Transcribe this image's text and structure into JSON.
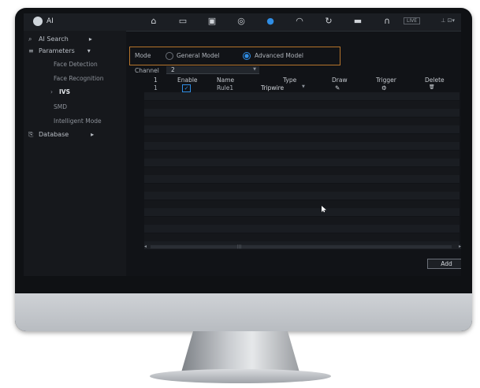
{
  "app": {
    "title": "AI"
  },
  "top_icons": [
    "home-icon",
    "monitor-icon",
    "playback-icon",
    "network-icon",
    "ai-icon",
    "speed-icon",
    "refresh-icon",
    "display-icon",
    "headset-icon"
  ],
  "top_right": {
    "live": "LIVE",
    "icons": "⊥ ⊡▾"
  },
  "sidebar": {
    "items": [
      {
        "label": "AI Search",
        "icon": "search-icon",
        "arrow": "▸"
      },
      {
        "label": "Parameters",
        "icon": "list-icon",
        "arrow": "▾"
      },
      {
        "label": "Database",
        "icon": "database-icon",
        "arrow": "▸"
      }
    ],
    "subitems": [
      {
        "label": "Face Detection"
      },
      {
        "label": "Face Recognition"
      },
      {
        "label": "IVS",
        "active": true
      },
      {
        "label": "SMD"
      },
      {
        "label": "Intelligent Mode"
      }
    ]
  },
  "mode": {
    "label": "Mode",
    "options": [
      {
        "label": "General Model",
        "selected": false
      },
      {
        "label": "Advanced Model",
        "selected": true
      }
    ]
  },
  "channel": {
    "label": "Channel",
    "value": "2"
  },
  "table": {
    "headers": [
      "1",
      "Enable",
      "Name",
      "Type",
      "Draw",
      "Trigger",
      "Delete"
    ],
    "rows": [
      {
        "index": "1",
        "enabled": true,
        "name": "Rule1",
        "type": "Tripwire",
        "draw": "✎",
        "trigger": "⚙",
        "delete": "🗑"
      }
    ]
  },
  "buttons": {
    "add": "Add"
  },
  "colors": {
    "accent": "#2f8de4",
    "highlight_border": "#b5742b",
    "background": "#111317"
  }
}
